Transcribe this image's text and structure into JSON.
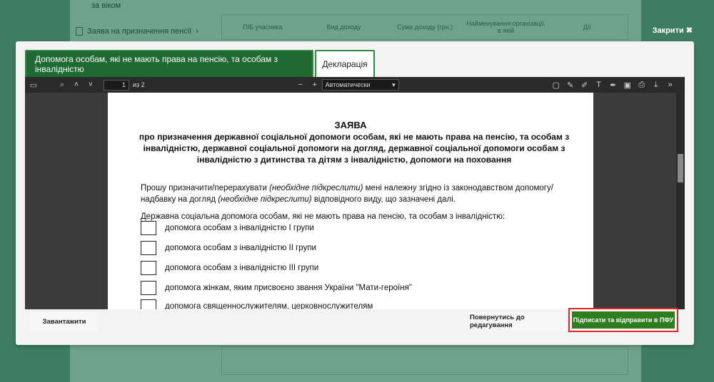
{
  "background": {
    "left_text": "за віком",
    "link_text": "Заява на призначення пенсії",
    "table_headers": [
      "ПІБ учасника",
      "Вид доходу",
      "Сума доходу (грн.)",
      "Найменування організації, в якій",
      "Дії"
    ]
  },
  "close_label": "Закрити ✖",
  "tabs": [
    {
      "label": "Допомога особам, які не мають права на пенсію, та особам з інвалідністю",
      "active": true
    },
    {
      "label": "Декларація",
      "active": false
    }
  ],
  "viewer": {
    "page_number": "1",
    "page_total": "из 2",
    "zoom_value": "Автоматически"
  },
  "document": {
    "title": "ЗАЯВА",
    "subtitle": "про призначення державної соціальної допомоги особам, які не мають права на пенсію, та особам з інвалідністю, державної соціальної допомоги на догляд, державної соціальної допомоги особам з інвалідністю з дитинства та дітям з інвалідністю, допомоги на поховання",
    "para1_a": "Прошу призначити/перерахувати ",
    "para1_b": "(необхідне підкреслити)",
    "para1_c": " мені належну згідно із законодавством допомогу/ надбавку на догляд ",
    "para1_d": "(необхідне підкреслити)",
    "para1_e": " відповідного виду, що зазначені далі.",
    "para2": "Державна соціальна допомога особам, які не мають права на пенсію, та особам з інвалідністю:",
    "options": [
      "допомога особам з інвалідністю І групи",
      "допомога особам з інвалідністю ІІ групи",
      "допомога особам з інвалідністю ІІІ групи",
      "допомога жінкам, яким присвоєно звання України \"Мати-героїня\"",
      "допомога священнослужителям, церковнослужителям"
    ]
  },
  "buttons": {
    "download": "Завантажити",
    "back": "Повернутись до редагування",
    "sign": "Підписати та відправити в ПФУ"
  },
  "colors": {
    "overlay": "#3e7d63",
    "tab_active": "#1f6a32",
    "sign_button": "#2e7d1f",
    "highlight": "#e02525"
  }
}
